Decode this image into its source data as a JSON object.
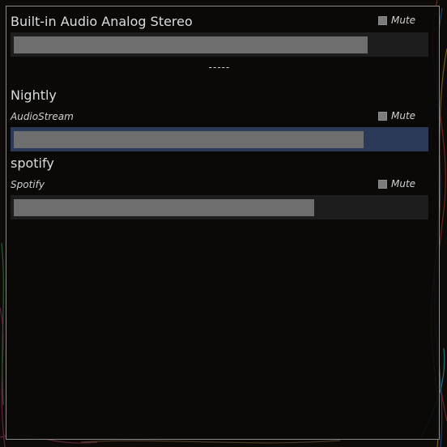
{
  "outputs": [
    {
      "title": "Built-in Audio Analog Stereo",
      "mute_label": "Mute",
      "muted": false,
      "volume": 0.86
    }
  ],
  "separator": "-----",
  "streams": [
    {
      "app_name": "Nightly",
      "stream_name": "AudioStream",
      "mute_label": "Mute",
      "muted": false,
      "volume": 0.85,
      "selected": true
    },
    {
      "app_name": "spotify",
      "stream_name": "Spotify",
      "mute_label": "Mute",
      "muted": false,
      "volume": 0.73,
      "selected": false
    }
  ],
  "colors": {
    "border": "#8a8a8a",
    "slider_track": "#1d1d1d",
    "slider_selected": "#2b3a58",
    "slider_fill": "#6e6e6e",
    "text": "#dcdcdc"
  }
}
